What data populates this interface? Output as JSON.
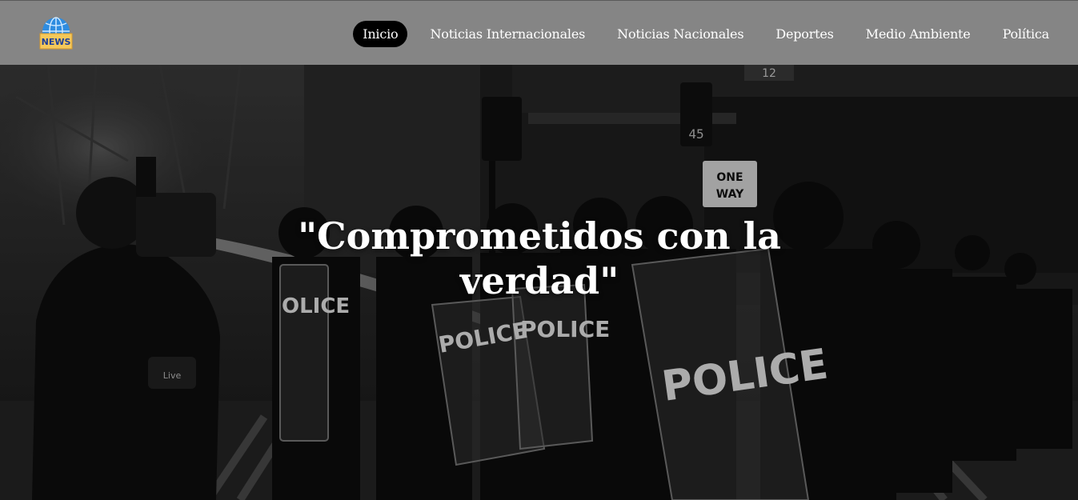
{
  "header": {
    "logo_icon": "news-globe-icon",
    "logo_text": "NEWS",
    "nav": [
      {
        "label": "Inicio",
        "active": true
      },
      {
        "label": "Noticias Internacionales",
        "active": false
      },
      {
        "label": "Noticias Nacionales",
        "active": false
      },
      {
        "label": "Deportes",
        "active": false
      },
      {
        "label": "Medio Ambiente",
        "active": false
      },
      {
        "label": "Política",
        "active": false
      }
    ]
  },
  "hero": {
    "title": "\"Comprometidos con la verdad\"",
    "image_icon": "protest-photo",
    "sign_one_way": "ONE WAY",
    "sign_street": "12",
    "sign_signal": "45",
    "shield_text": "POLICE",
    "camera_badge": "LIVE"
  },
  "colors": {
    "navbar_bg": "#858585",
    "active_pill": "#000000",
    "text": "#ffffff"
  }
}
